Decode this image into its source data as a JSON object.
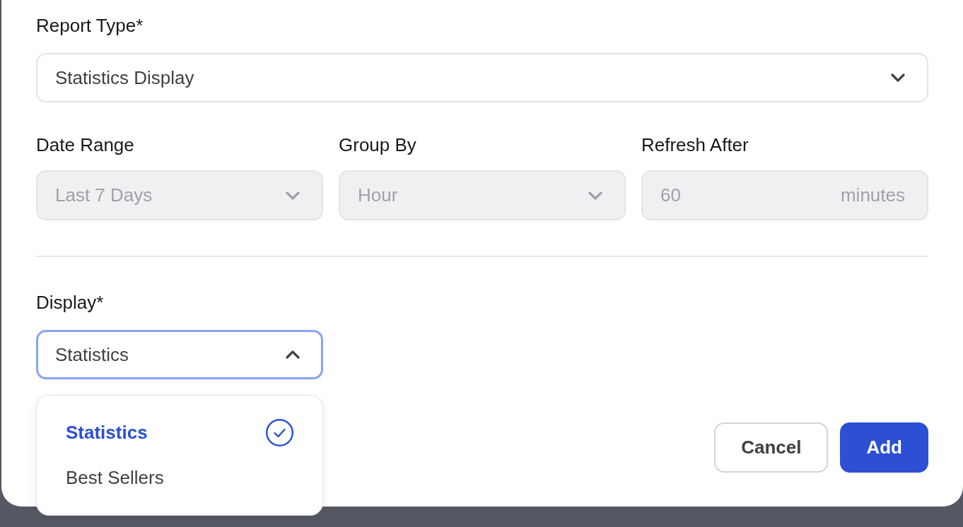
{
  "report_type": {
    "label": "Report Type*",
    "value": "Statistics Display",
    "expanded": false
  },
  "fields": [
    {
      "kind": "select",
      "label": "Date Range",
      "value": "Last 7 Days",
      "disabled": true
    },
    {
      "kind": "select",
      "label": "Group By",
      "value": "Hour",
      "disabled": true
    },
    {
      "kind": "input",
      "label": "Refresh After",
      "value": "60",
      "suffix": "minutes",
      "disabled": true
    }
  ],
  "display": {
    "label": "Display*",
    "value": "Statistics",
    "expanded": true,
    "options": [
      {
        "label": "Statistics",
        "selected": true
      },
      {
        "label": "Best Sellers",
        "selected": false
      }
    ]
  },
  "buttons": [
    {
      "label": "Cancel",
      "kind": "secondary"
    },
    {
      "label": "Add",
      "kind": "primary"
    }
  ]
}
